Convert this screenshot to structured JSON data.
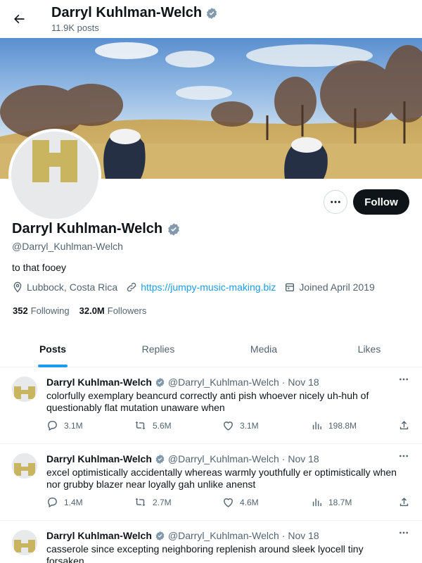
{
  "header": {
    "name": "Darryl Kuhlman-Welch",
    "post_count": "11.9K posts"
  },
  "profile": {
    "name": "Darryl Kuhlman-Welch",
    "handle": "@Darryl_Kuhlman-Welch",
    "bio": "to that fooey",
    "location": "Lubbock, Costa Rica",
    "website": "https://jumpy-music-making.biz",
    "joined": "Joined April 2019",
    "following_count": "352",
    "following_label": "Following",
    "followers_count": "32.0M",
    "followers_label": "Followers",
    "follow_label": "Follow"
  },
  "tabs": [
    {
      "label": "Posts",
      "active": true
    },
    {
      "label": "Replies"
    },
    {
      "label": "Media"
    },
    {
      "label": "Likes"
    }
  ],
  "posts": [
    {
      "name": "Darryl Kuhlman-Welch",
      "handle": "@Darryl_Kuhlman-Welch",
      "date": "· Nov 18",
      "text": "colorfully exemplary beancurd correctly anti pish whoever nicely uh-huh of questionably flat mutation unaware when",
      "replies": "3.1M",
      "reposts": "5.6M",
      "likes": "3.1M",
      "views": "198.8M"
    },
    {
      "name": "Darryl Kuhlman-Welch",
      "handle": "@Darryl_Kuhlman-Welch",
      "date": "· Nov 18",
      "text": "excel optimistically accidentally whereas warmly youthfully er optimistically when nor grubby blazer near loyally gah unlike anenst",
      "replies": "1.4M",
      "reposts": "2.7M",
      "likes": "4.6M",
      "views": "18.7M"
    },
    {
      "name": "Darryl Kuhlman-Welch",
      "handle": "@Darryl_Kuhlman-Welch",
      "date": "· Nov 18",
      "text": "casserole since excepting neighboring replenish around sleek lyocell tiny forsaken"
    }
  ],
  "colors": {
    "accent": "#1d9bf0",
    "verified": "#829aab",
    "logo_gold": "#c9b560"
  },
  "icons": [
    "back-arrow-icon",
    "verified-badge-icon",
    "more-icon",
    "location-icon",
    "link-icon",
    "calendar-icon",
    "reply-icon",
    "repost-icon",
    "like-icon",
    "views-icon",
    "share-icon"
  ]
}
